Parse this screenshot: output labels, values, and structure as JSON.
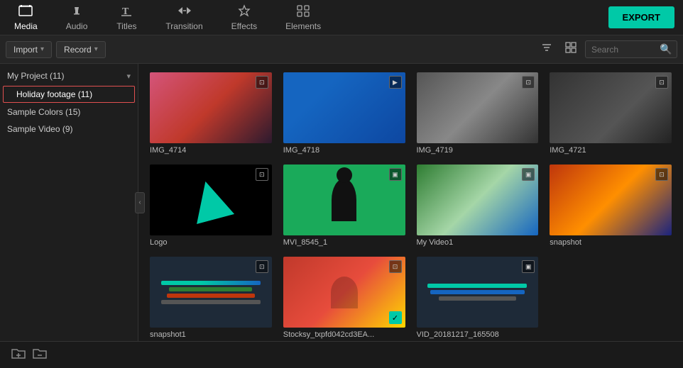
{
  "nav": {
    "items": [
      {
        "id": "media",
        "label": "Media",
        "icon": "🎞",
        "active": true
      },
      {
        "id": "audio",
        "label": "Audio",
        "icon": "♪"
      },
      {
        "id": "titles",
        "label": "Titles",
        "icon": "T"
      },
      {
        "id": "transition",
        "label": "Transition",
        "icon": "⇄"
      },
      {
        "id": "effects",
        "label": "Effects",
        "icon": "✦"
      },
      {
        "id": "elements",
        "label": "Elements",
        "icon": "⊞"
      }
    ],
    "export_label": "EXPORT"
  },
  "toolbar": {
    "import_label": "Import",
    "record_label": "Record",
    "search_placeholder": "Search"
  },
  "sidebar": {
    "my_project": "My Project (11)",
    "holiday_footage": "Holiday footage (11)",
    "sample_colors": "Sample Colors (15)",
    "sample_video": "Sample Video (9)"
  },
  "media_items": [
    {
      "id": 1,
      "label": "IMG_4714",
      "type": "image",
      "bg": "pink"
    },
    {
      "id": 2,
      "label": "IMG_4718",
      "type": "video",
      "bg": "blue"
    },
    {
      "id": 3,
      "label": "IMG_4719",
      "type": "image",
      "bg": "street"
    },
    {
      "id": 4,
      "label": "IMG_4721",
      "type": "image",
      "bg": "dark_street"
    },
    {
      "id": 5,
      "label": "Logo",
      "type": "image",
      "bg": "logo"
    },
    {
      "id": 6,
      "label": "MVI_8545_1",
      "type": "video",
      "bg": "green"
    },
    {
      "id": 7,
      "label": "My Video1",
      "type": "video",
      "bg": "river"
    },
    {
      "id": 8,
      "label": "snapshot",
      "type": "image",
      "bg": "sunset"
    },
    {
      "id": 9,
      "label": "snapshot1",
      "type": "image",
      "bg": "screenshot"
    },
    {
      "id": 10,
      "label": "Stocksy_txpfd042cd3EA...",
      "type": "image",
      "bg": "person",
      "checked": true
    },
    {
      "id": 11,
      "label": "VID_20181217_165508",
      "type": "video",
      "bg": "screenshot2"
    }
  ],
  "bottom": {
    "add_folder_icon": "📁",
    "remove_icon": "✕"
  }
}
